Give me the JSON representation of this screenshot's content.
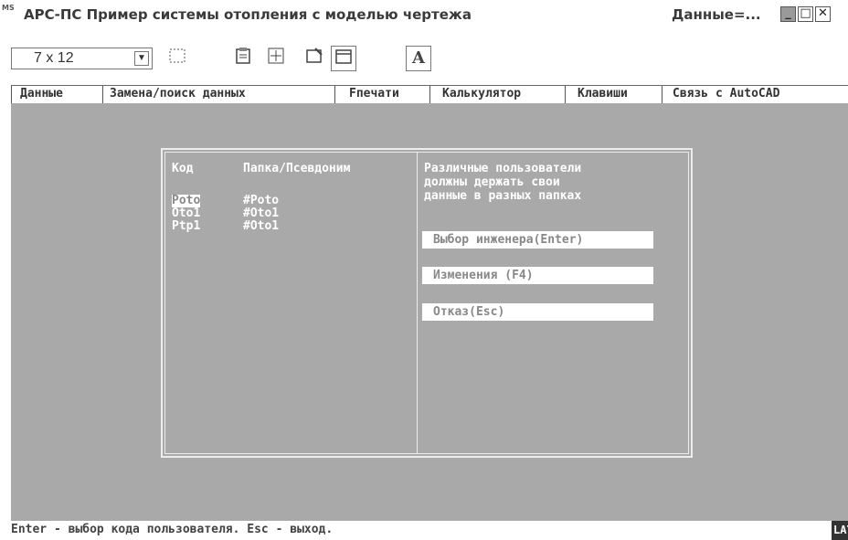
{
  "window": {
    "app_icon_text": "MS",
    "title": "АРС-ПС  Пример системы отопления с моделью чертежа",
    "title_right": "Данные=...",
    "minimize": "_",
    "maximize": "□",
    "close": "✕"
  },
  "toolbar": {
    "font_size_value": "7 x 12",
    "font_label": "A"
  },
  "menu": {
    "items": [
      "Данные",
      "Замена/поиск данных",
      "Fпечати",
      "Калькулятор",
      "Клавиши",
      "Связь с AutoCAD"
    ]
  },
  "dialog": {
    "headers": {
      "code": "Код",
      "folder": "Папка/Псевдоним"
    },
    "rows": [
      {
        "code": "Poto",
        "folder": "#Poto",
        "selected": true
      },
      {
        "code": "Oto1",
        "folder": "#Oto1",
        "selected": false
      },
      {
        "code": "Ptp1",
        "folder": "#Oto1",
        "selected": false
      }
    ],
    "info_lines": [
      "Различные пользователи",
      "должны держать свои",
      "данные в разных папках"
    ],
    "buttons": {
      "select_engineer": "Выбор инженера(Enter)",
      "changes": "Изменения (F4)",
      "cancel": "Отказ(Esc)"
    }
  },
  "status": {
    "text": "Enter - выбор кода пользователя. Esc - выход.",
    "layout_indicator": "LAT"
  },
  "colors": {
    "screen_bg": "#a9a9a9",
    "text": "#ffffff",
    "button_bg": "#ffffff",
    "button_text": "#888888"
  }
}
